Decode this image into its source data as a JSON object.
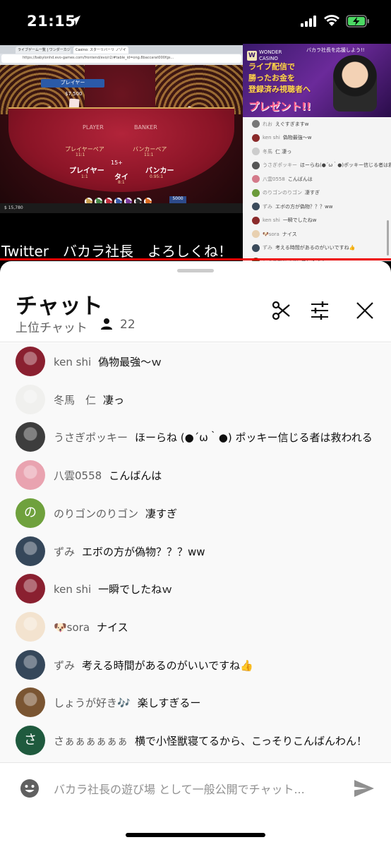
{
  "status_bar": {
    "time": "21:15",
    "icons": [
      "location-arrow-icon",
      "cellular-signal-icon",
      "wifi-icon",
      "battery-charging-icon"
    ]
  },
  "video": {
    "overlay_text": "Twitter　バカラ社長　よろしくね！",
    "browser": {
      "tabs": [
        "ライブゲーム一覧 | ワンダーカジノ",
        "Casino: スターリバーリ ノゾイ"
      ],
      "url": "https://babylonhd.evo-games.com/frontend/evo/r2/#table_id=ong.8baccarat000fgs..."
    },
    "game": {
      "player_badge": "プレイヤー",
      "bet_amount": "$7,500",
      "labels": {
        "player": "PLAYER",
        "banker": "BANKER",
        "player_pair": "プレイヤーペア",
        "player_pair_odds": "11:1",
        "banker_pair": "バンカーペア",
        "banker_pair_odds": "11:1",
        "player_big": "プレイヤー",
        "player_odds": "1:1",
        "tie": "タイ",
        "tie_odds": "8:1",
        "banker_big": "バンカー",
        "banker_odds": "0.95:1",
        "bet_chip": "15+"
      },
      "balance": "5000",
      "bottom_left": "$ 15,780"
    },
    "ad": {
      "brand": "WONDER CASINO",
      "brand_mark": "W",
      "top_text": "バカラ社長を応援しよう!!",
      "line1": "ライブ配信で",
      "line2": "勝ったお金を",
      "line3": "登録済み視聴者へ",
      "line4": "プレゼント!!"
    },
    "mini_chat": [
      {
        "name": "れお",
        "text": "えぐすぎますw",
        "color": "#777777"
      },
      {
        "name": "ken shi",
        "text": "偽物最強〜w",
        "color": "#8a2a2a"
      },
      {
        "name": "冬馬",
        "text": "仁  凄っ",
        "color": "#cccccc"
      },
      {
        "name": "うさぎポッキー",
        "text": "ほーらね(●´ω｀●)ポッキー信じる者は救われる",
        "color": "#555555"
      },
      {
        "name": "八雲0558",
        "text": "こんばんは",
        "color": "#d47a8a"
      },
      {
        "name": "のりゴンのりゴン",
        "text": "凄すぎ",
        "color": "#6a9a3a"
      },
      {
        "name": "ずみ",
        "text": "エボの方が偽物？？？ww",
        "color": "#3a4a5a"
      },
      {
        "name": "ken shi",
        "text": "一瞬でしたねw",
        "color": "#8a2a2a"
      },
      {
        "name": "🐶sora",
        "text": "ナイス",
        "color": "#e8d0b0"
      },
      {
        "name": "ずみ",
        "text": "考える時間があるのがいいですね👍",
        "color": "#3a4a5a"
      },
      {
        "name": "しょうが好き🎶",
        "text": "楽しすぎるー",
        "color": "#6a4a2a"
      }
    ]
  },
  "chat": {
    "title": "チャット",
    "subtitle": "上位チャット",
    "viewer_count": "22",
    "messages": [
      {
        "author": "ken shi",
        "text": "偽物最強〜ｗ",
        "avatar": "#8a2030",
        "letter": ""
      },
      {
        "author": "冬馬　仁",
        "text": "凄っ",
        "avatar": "#f0f0ee",
        "letter": ""
      },
      {
        "author": "うさぎポッキー",
        "text": "ほーらね (●´ω｀●) ポッキー信じる者は救われる",
        "avatar": "#3d3d3d",
        "letter": ""
      },
      {
        "author": "八雲0558",
        "text": "こんばんは",
        "avatar": "#e9a3b0",
        "letter": ""
      },
      {
        "author": "のりゴンのりゴン",
        "text": "凄すぎ",
        "avatar": "#6fa13d",
        "letter": "の"
      },
      {
        "author": "ずみ",
        "text": "エボの方が偽物？？？ww",
        "avatar": "#35475a",
        "letter": ""
      },
      {
        "author": "ken shi",
        "text": "一瞬でしたねｗ",
        "avatar": "#8a2030",
        "letter": ""
      },
      {
        "author": "🐶sora",
        "text": "ナイス",
        "avatar": "#f3e3cf",
        "letter": ""
      },
      {
        "author": "ずみ",
        "text": "考える時間があるのがいいですね👍",
        "avatar": "#35475a",
        "letter": ""
      },
      {
        "author": "しょうが好き🎶",
        "text": "楽しすぎるー",
        "avatar": "#7a5532",
        "letter": ""
      },
      {
        "author": "さぁぁぁぁぁぁ",
        "text": "横で小怪獣寝てるから、こっそりこんばんわん！",
        "avatar": "#1f5a3e",
        "letter": "さ"
      }
    ],
    "input_placeholder": "バカラ社長の遊び場 として一般公開でチャット...",
    "icons": {
      "clip": "scissors-icon",
      "filter": "sliders-icon",
      "close": "close-icon",
      "emoji": "emoji-icon",
      "send": "send-icon",
      "viewers": "person-icon"
    }
  }
}
